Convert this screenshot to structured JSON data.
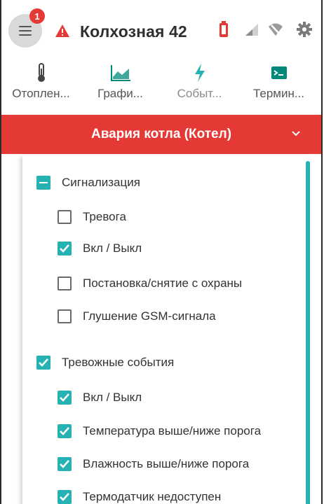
{
  "header": {
    "notification_count": "1",
    "title": "Колхозная 42"
  },
  "tabs": [
    {
      "label": "Отоплен...",
      "icon": "thermometer-icon"
    },
    {
      "label": "Графи...",
      "icon": "chart-icon"
    },
    {
      "label": "Событ...",
      "icon": "lightning-icon"
    },
    {
      "label": "Термин...",
      "icon": "terminal-icon"
    }
  ],
  "alarm": {
    "label": "Авария котла (Котел)"
  },
  "groups": [
    {
      "label": "Сигнализация",
      "state": "partial",
      "items": [
        {
          "label": "Тревога",
          "checked": false
        },
        {
          "label": "Вкл / Выкл",
          "checked": true
        },
        {
          "label": "Постановка/снятие с охраны",
          "checked": false
        },
        {
          "label": "Глушение GSM-сигнала",
          "checked": false
        }
      ]
    },
    {
      "label": "Тревожные события",
      "state": "checked",
      "items": [
        {
          "label": "Вкл / Выкл",
          "checked": true
        },
        {
          "label": "Температура выше/ниже порога",
          "checked": true
        },
        {
          "label": "Влажность выше/ниже порога",
          "checked": true
        },
        {
          "label": "Термодатчик недоступен",
          "checked": true
        }
      ]
    }
  ],
  "colors": {
    "accent": "#26b2b2",
    "alarm": "#e53935",
    "badge": "#e53935"
  }
}
